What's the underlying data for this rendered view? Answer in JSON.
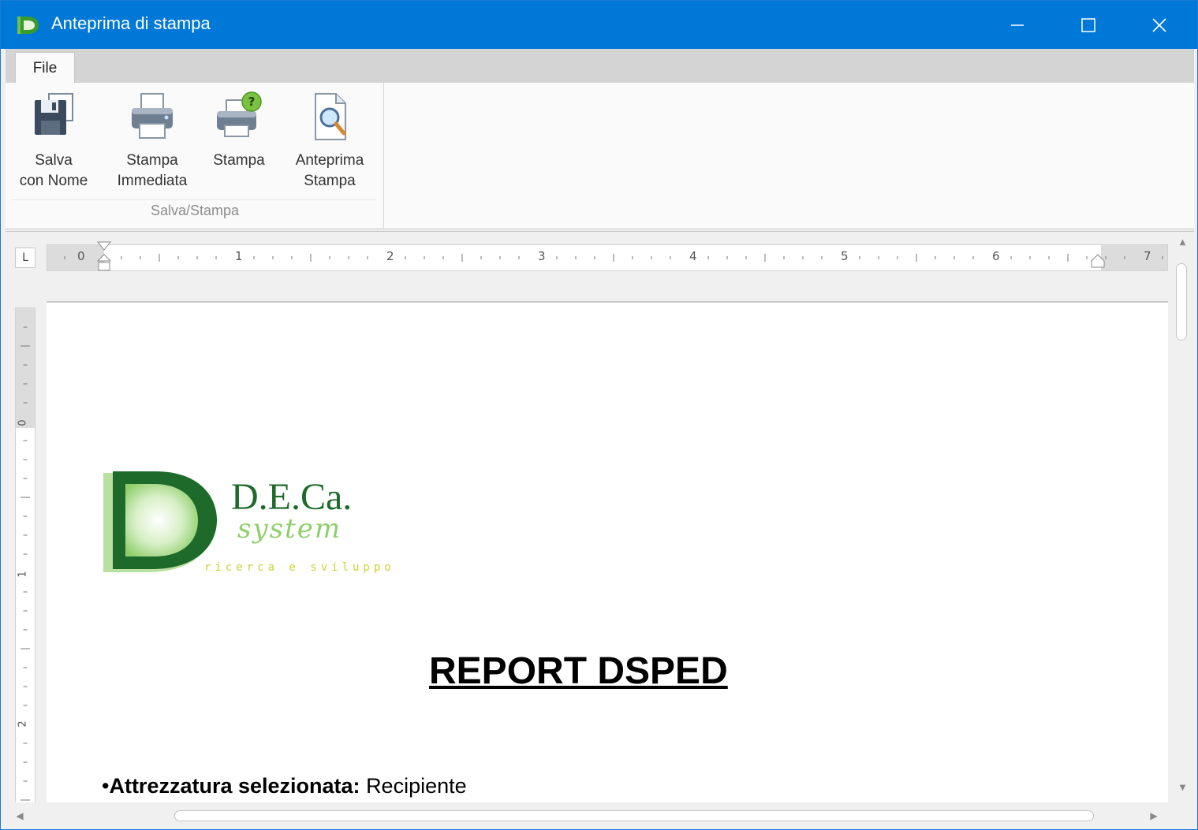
{
  "window": {
    "title": "Anteprima di stampa",
    "icon": "deca-app-icon",
    "controls": [
      "minimize-icon",
      "maximize-icon",
      "close-icon"
    ]
  },
  "ribbon": {
    "tabs": [
      {
        "label": "File",
        "active": true
      }
    ],
    "groups": [
      {
        "label": "Salva/Stampa",
        "buttons": [
          {
            "label": "Salva\ncon Nome",
            "icon": "save-as-icon"
          },
          {
            "label": "Stampa\nImmediata",
            "icon": "printer-icon"
          },
          {
            "label": "Stampa",
            "icon": "print-dialog-icon"
          },
          {
            "label": "Anteprima\nStampa",
            "icon": "print-preview-icon"
          }
        ]
      }
    ]
  },
  "ruler": {
    "corner_glyph": "L",
    "horizontal_numbers": [
      "0",
      "1",
      "2",
      "3",
      "4",
      "5",
      "6",
      "7"
    ],
    "vertical_numbers": [
      "0",
      "1",
      "2"
    ]
  },
  "document": {
    "logo": {
      "name": "D.E.Ca.",
      "tagline": "system",
      "subtitle": "ricerca e sviluppo"
    },
    "title": "REPORT DSPED",
    "fields": [
      {
        "label": "Attrezzatura selezionata:",
        "value": "Recipiente"
      }
    ]
  },
  "colors": {
    "titlebar": "#0078d7",
    "logo_dark_green": "#1d6a2a",
    "logo_light_green": "#8fcf6a"
  }
}
